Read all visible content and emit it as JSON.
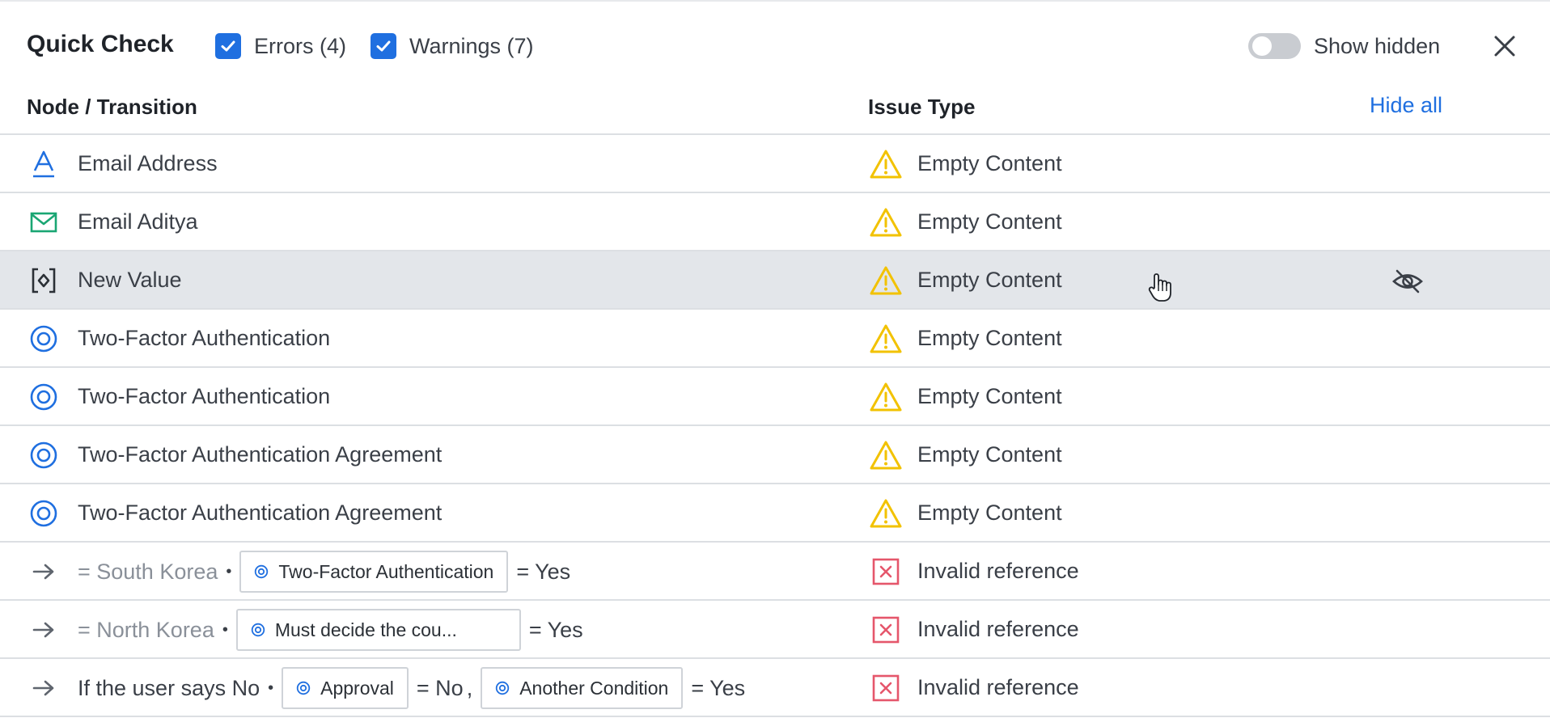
{
  "header": {
    "title": "Quick Check",
    "errors_label": "Errors (4)",
    "warnings_label": "Warnings (7)",
    "show_hidden_label": "Show hidden",
    "errors_checked": true,
    "warnings_checked": true,
    "show_hidden_on": false
  },
  "columns": {
    "node": "Node / Transition",
    "issue": "Issue Type",
    "hide_all": "Hide all"
  },
  "colors": {
    "accent": "#1f6fe0",
    "warning": "#f2c200",
    "error": "#e5566b",
    "email_icon": "#1aa673",
    "highlight_row": "#e3e6ea"
  },
  "rows": [
    {
      "icon": "text-field-icon",
      "name": "Email Address",
      "issue_icon": "warning-icon",
      "issue": "Empty Content"
    },
    {
      "icon": "email-icon",
      "name": "Email Aditya",
      "issue_icon": "warning-icon",
      "issue": "Empty Content"
    },
    {
      "icon": "variable-icon",
      "name": "New Value",
      "issue_icon": "warning-icon",
      "issue": "Empty Content",
      "highlighted": true
    },
    {
      "icon": "condition-icon",
      "name": "Two-Factor Authentication",
      "issue_icon": "warning-icon",
      "issue": "Empty Content"
    },
    {
      "icon": "condition-icon",
      "name": "Two-Factor Authentication",
      "issue_icon": "warning-icon",
      "issue": "Empty Content"
    },
    {
      "icon": "condition-icon",
      "name": "Two-Factor Authentication Agreement",
      "issue_icon": "warning-icon",
      "issue": "Empty Content"
    },
    {
      "icon": "condition-icon",
      "name": "Two-Factor Authentication Agreement",
      "issue_icon": "warning-icon",
      "issue": "Empty Content"
    }
  ],
  "transitions": [
    {
      "icon": "arrow-right-icon",
      "prefix": "= South Korea",
      "chip": "Two-Factor Authentication",
      "suffix": "= Yes",
      "issue_icon": "error-icon",
      "issue": "Invalid reference"
    },
    {
      "icon": "arrow-right-icon",
      "prefix": "= North Korea",
      "chip": "Must decide the cou...",
      "suffix": "= Yes",
      "issue_icon": "error-icon",
      "issue": "Invalid reference"
    },
    {
      "icon": "arrow-right-icon",
      "prefix": "If the user says No",
      "chip": "Approval",
      "middle": "= No",
      "comma": ",",
      "chip2": "Another Condition",
      "suffix": "= Yes",
      "issue_icon": "error-icon",
      "issue": "Invalid reference"
    }
  ]
}
